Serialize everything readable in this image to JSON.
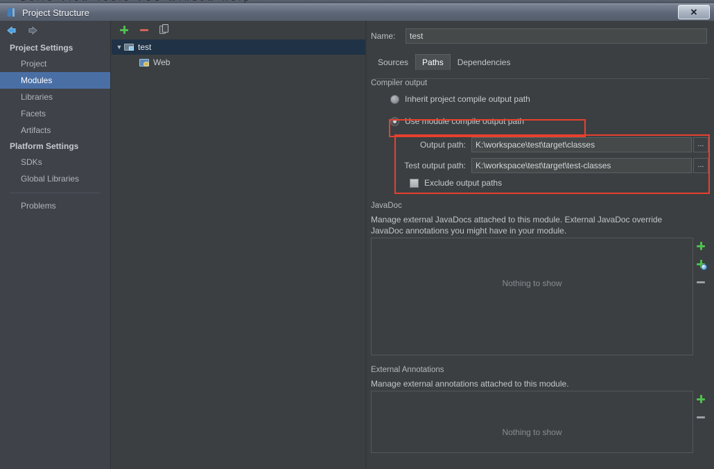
{
  "menubar": {
    "items": [
      "Build",
      "View",
      "Tools",
      "VCS",
      "Window",
      "Help"
    ]
  },
  "titlebar": {
    "title": "Project Structure",
    "app_icon": "intellij-idea-icon",
    "close_label": "✕"
  },
  "nav": {
    "back_icon": "arrow-left-icon",
    "forward_icon": "arrow-right-icon"
  },
  "sidebar": {
    "sections": [
      {
        "header": "Project Settings",
        "items": [
          {
            "label": "Project",
            "selected": false
          },
          {
            "label": "Modules",
            "selected": true
          },
          {
            "label": "Libraries",
            "selected": false
          },
          {
            "label": "Facets",
            "selected": false
          },
          {
            "label": "Artifacts",
            "selected": false
          }
        ]
      },
      {
        "header": "Platform Settings",
        "items": [
          {
            "label": "SDKs",
            "selected": false
          },
          {
            "label": "Global Libraries",
            "selected": false
          }
        ]
      }
    ],
    "problems": {
      "label": "Problems",
      "selected": false
    }
  },
  "tree": {
    "toolbar": [
      {
        "name": "add-module-button",
        "icon": "plus-icon"
      },
      {
        "name": "remove-module-button",
        "icon": "minus-icon"
      },
      {
        "name": "copy-module-button",
        "icon": "copy-icon"
      }
    ],
    "nodes": [
      {
        "label": "test",
        "icon": "module-icon",
        "selected": true,
        "expanded": true,
        "twisty": "▼"
      },
      {
        "label": "Web",
        "icon": "web-facet-icon",
        "selected": false,
        "child": true
      }
    ]
  },
  "main": {
    "name_label": "Name:",
    "name_value": "test",
    "tabs": [
      {
        "label": "Sources",
        "active": false
      },
      {
        "label": "Paths",
        "active": true
      },
      {
        "label": "Dependencies",
        "active": false
      }
    ],
    "compiler_output": {
      "group_title": "Compiler output",
      "radio_inherit": "Inherit project compile output path",
      "radio_module": "Use module compile output path",
      "selected_radio": "module",
      "output_path_label": "Output path:",
      "output_path_value": "K:\\workspace\\test\\target\\classes",
      "test_output_path_label": "Test output path:",
      "test_output_path_value": "K:\\workspace\\test\\target\\test-classes",
      "browse_label": "...",
      "exclude_label": "Exclude output paths",
      "exclude_checked": false,
      "highlight_color": "#e8402e"
    },
    "javadoc": {
      "group_title": "JavaDoc",
      "description": "Manage external JavaDocs attached to this module. External JavaDoc override JavaDoc annotations you might have in your module.",
      "empty_text": "Nothing to show",
      "buttons": [
        {
          "name": "add-javadoc-path-button",
          "icon": "plus-icon"
        },
        {
          "name": "add-javadoc-url-button",
          "icon": "plus-globe-icon"
        },
        {
          "name": "remove-javadoc-button",
          "icon": "minus-icon"
        }
      ]
    },
    "external_annotations": {
      "group_title": "External Annotations",
      "description": "Manage external annotations attached to this module.",
      "empty_text": "Nothing to show",
      "buttons": [
        {
          "name": "add-annotation-button",
          "icon": "plus-icon"
        },
        {
          "name": "remove-annotation-button",
          "icon": "minus-icon"
        }
      ]
    }
  },
  "colors": {
    "background": "#3c3f41",
    "sidebar": "#3f4249",
    "selection": "#4a6fa5",
    "tree_selection": "#1f3246",
    "accent_red": "#e8402e",
    "accent_green": "#4fbf4f"
  }
}
